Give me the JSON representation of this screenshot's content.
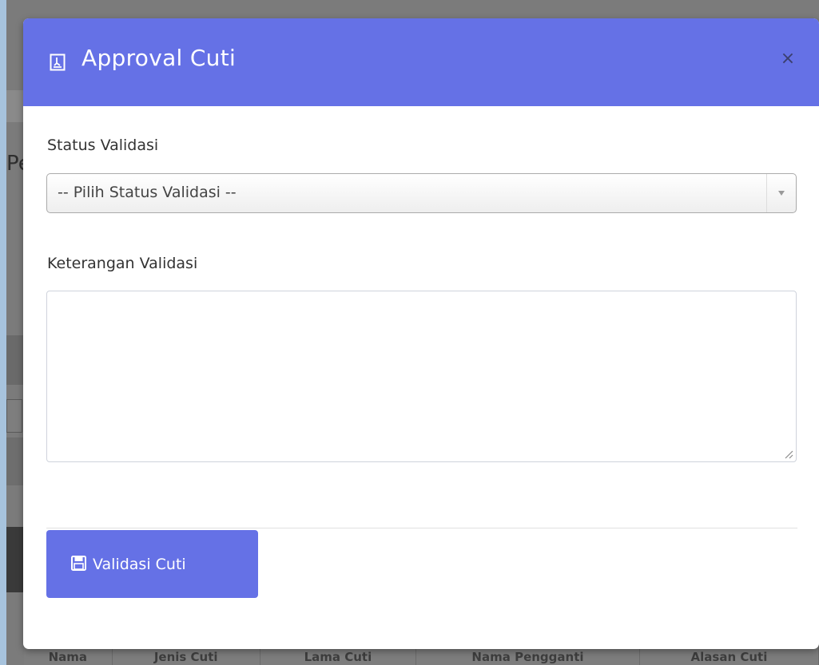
{
  "modal": {
    "title": "Approval Cuti",
    "close_symbol": "×",
    "header_icon": "document-icon",
    "accent_color": "#6571e6"
  },
  "form": {
    "status_label": "Status Validasi",
    "status_select_value": "-- Pilih Status Validasi --",
    "keterangan_label": "Keterangan Validasi",
    "keterangan_value": "",
    "submit_label": "Validasi Cuti",
    "submit_icon": "save-icon"
  },
  "background": {
    "partial_letter": "Pe",
    "table_headers": [
      "Nama",
      "Jenis Cuti",
      "Lama Cuti",
      "Nama Pengganti",
      "Alasan Cuti"
    ]
  }
}
